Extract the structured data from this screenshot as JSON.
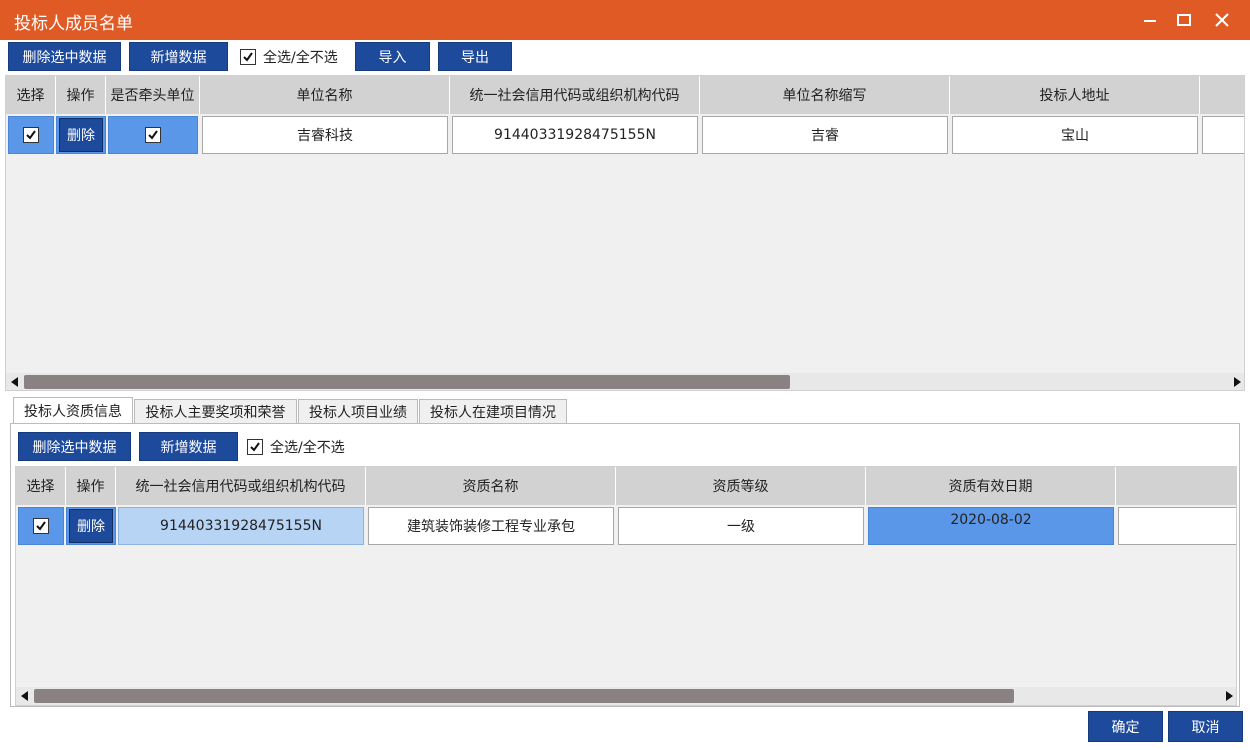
{
  "window": {
    "title": "投标人成员名单"
  },
  "toolbar": {
    "delete_selected": "删除选中数据",
    "add_data": "新增数据",
    "select_all": "全选/全不选",
    "import": "导入",
    "export": "导出"
  },
  "members_table": {
    "columns": [
      "选择",
      "操作",
      "是否牵头单位",
      "单位名称",
      "统一社会信用代码或组织机构代码",
      "单位名称缩写",
      "投标人地址"
    ],
    "rows": [
      {
        "selected": true,
        "action": "删除",
        "is_lead": true,
        "unit_name": "吉睿科技",
        "credit_code": "91440331928475155N",
        "short_name": "吉睿",
        "address": "宝山"
      }
    ]
  },
  "tabs": [
    "投标人资质信息",
    "投标人主要奖项和荣誉",
    "投标人项目业绩",
    "投标人在建项目情况"
  ],
  "sub_toolbar": {
    "delete_selected": "删除选中数据",
    "add_data": "新增数据",
    "select_all": "全选/全不选"
  },
  "qual_table": {
    "columns": [
      "选择",
      "操作",
      "统一社会信用代码或组织机构代码",
      "资质名称",
      "资质等级",
      "资质有效日期"
    ],
    "rows": [
      {
        "selected": true,
        "action": "删除",
        "credit_code": "91440331928475155N",
        "qual_name": "建筑装饰装修工程专业承包",
        "qual_level": "一级",
        "valid_date": "2020-08-02"
      }
    ]
  },
  "footer": {
    "ok": "确定",
    "cancel": "取消"
  },
  "colors": {
    "title_bar": "#e05a26",
    "button": "#1e4a9c",
    "selected_cell": "#5b97e8",
    "header": "#d2d2d2"
  }
}
